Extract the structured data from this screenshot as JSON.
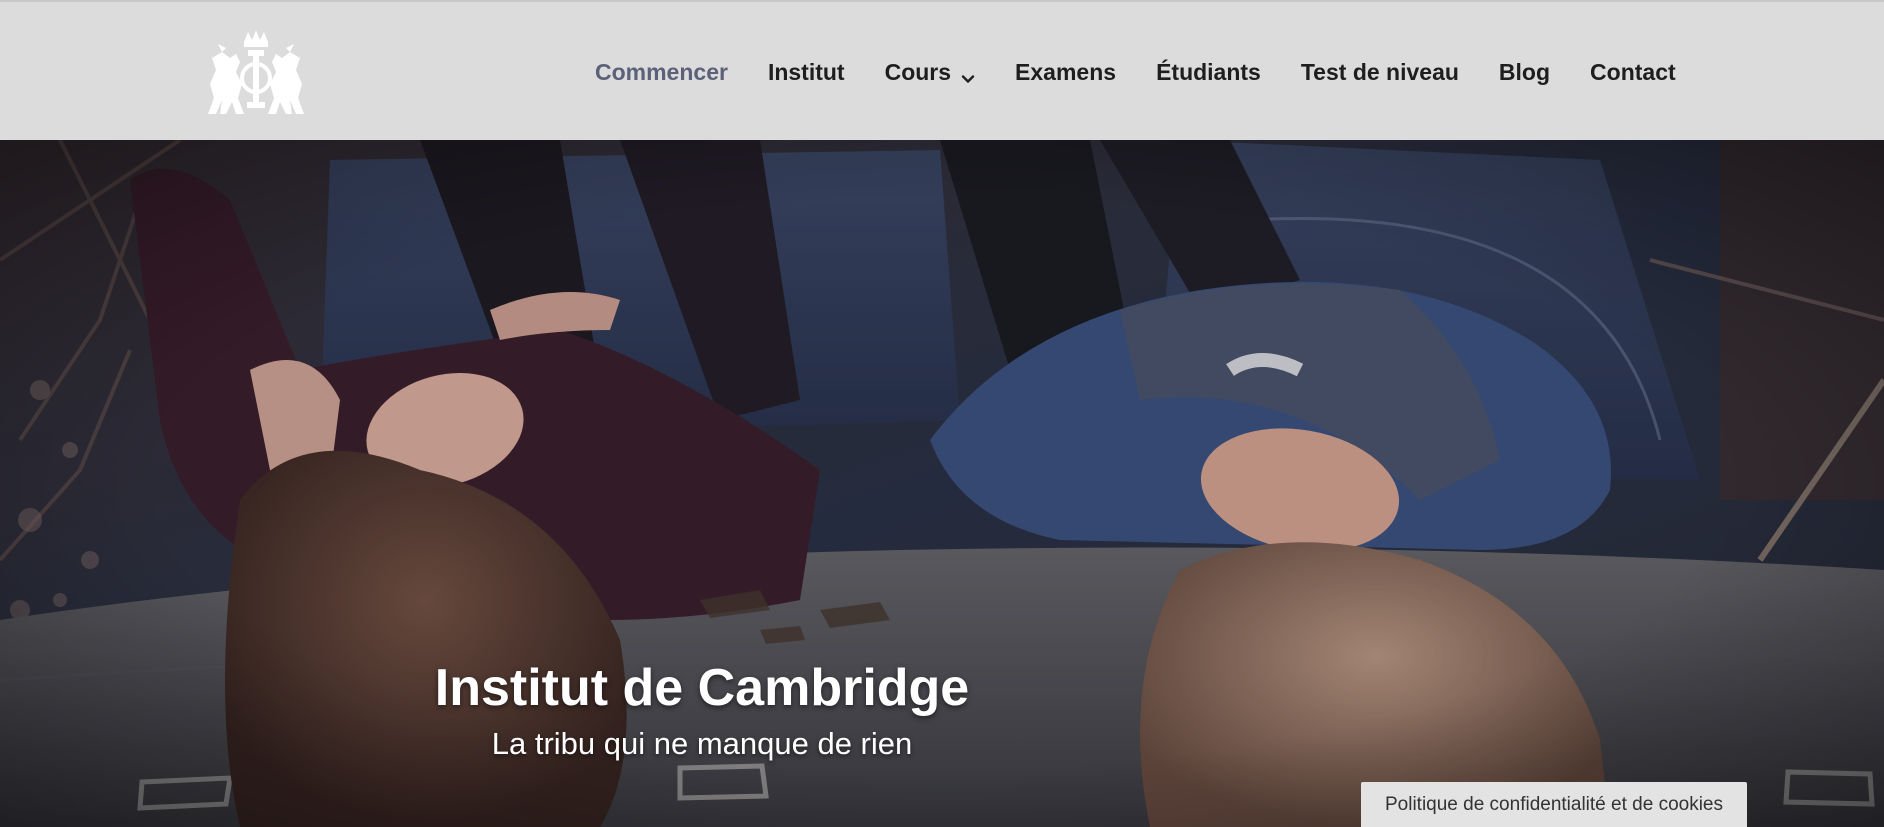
{
  "nav": {
    "items": [
      {
        "label": "Commencer",
        "active": true
      },
      {
        "label": "Institut"
      },
      {
        "label": "Cours",
        "has_dropdown": true
      },
      {
        "label": "Examens"
      },
      {
        "label": "Étudiants"
      },
      {
        "label": "Test de niveau"
      },
      {
        "label": "Blog"
      },
      {
        "label": "Contact"
      }
    ]
  },
  "logo": {
    "icon": "heraldic-crest-icon",
    "color": "#ffffff"
  },
  "hero": {
    "title": "Institut de Cambridge",
    "subtitle": "La tribu qui ne manque de rien"
  },
  "cookie_banner": {
    "label": "Politique de confidentialité et de cookies"
  },
  "colors": {
    "header_bg": "#dcdcdc",
    "nav_text": "#1e1e1e",
    "nav_active": "#5b6178",
    "hero_text": "#ffffff"
  }
}
